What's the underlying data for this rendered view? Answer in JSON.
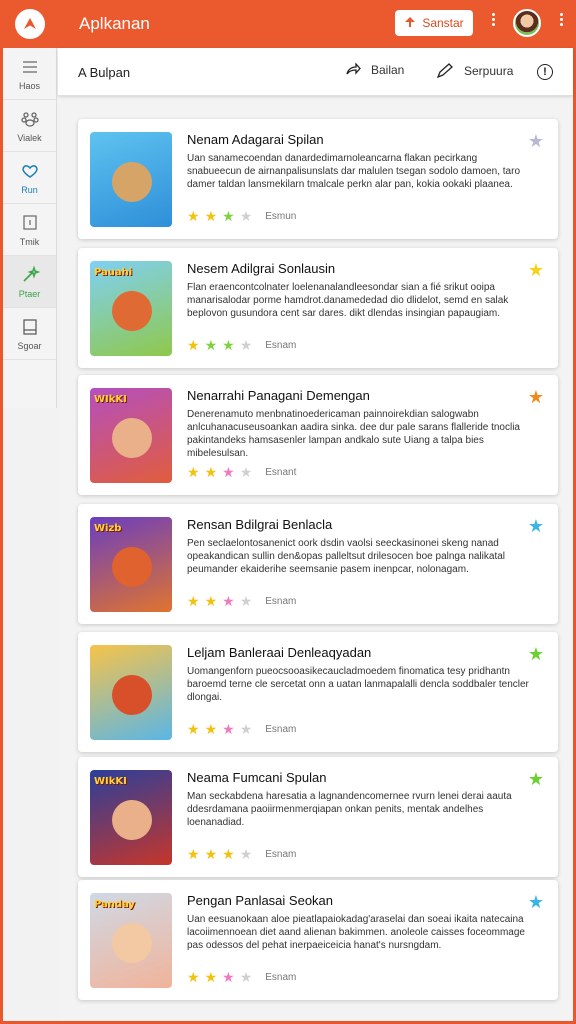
{
  "header": {
    "app_title": "Aplkanan",
    "signin_label": "Sanstar"
  },
  "sidebar": {
    "items": [
      {
        "label": "Haos",
        "icon": "list-icon"
      },
      {
        "label": "Vialek",
        "icon": "paw-icon"
      },
      {
        "label": "Run",
        "icon": "heart-icon"
      },
      {
        "label": "Tmik",
        "icon": "square-icon"
      },
      {
        "label": "Ptaer",
        "icon": "wand-icon",
        "active": true
      },
      {
        "label": "Sgoar",
        "icon": "box-icon"
      }
    ]
  },
  "subheader": {
    "title": "A Bulpan",
    "action1": "Bailan",
    "action2": "Serpuura",
    "info": "!"
  },
  "cards": [
    {
      "title": "Nenam Adagarai Spilan",
      "desc": "Uan sanamecoendan danardedimarnoleancarna flakan pecirkang snabueecun de airnanpalisunslats dar malulen tsegan sodolo damoen, taro damer taldan lansmekilarn tmalcale perkn alar pan, kokia ookaki plaanea.",
      "stars": [
        "#f3c10f",
        "#f3c10f",
        "#7fd23c",
        "#d0d0d0"
      ],
      "label": "Esmun",
      "fav_color": "#b8b8d0",
      "thumb_bg": "linear-gradient(160deg,#5ec3f0,#2e8fd8)",
      "face": "#d7a467",
      "badge": ""
    },
    {
      "title": "Nesem Adilgrai Sonlausin",
      "desc": "Flan eraencontcolnater loelenanalandleesondar sian a fié srikut ooipa manarisalodar porme hamdrot.danamededad dio dlidelot, semd en salak beplovon gusundora cent sar dares. dikt dlendas insingian papaugiam.",
      "stars": [
        "#f3c10f",
        "#7fd23c",
        "#7fd23c",
        "#d0d0d0"
      ],
      "label": "Esnam",
      "fav_color": "#f7d21a",
      "thumb_bg": "linear-gradient(160deg,#7fd0f5,#8fc84a)",
      "face": "#e06a33",
      "badge": "Pauahi"
    },
    {
      "title": "Nenarrahi Panagani Demengan",
      "desc": "Denerenamuto menbnatinoedericaman painnoirekdian salogwabn anlcuhanacuseusoankan aadira sinka. dee dur pale sarans flalleride tnoclia pakintandeks hamsasenler lampan andkalo sute Uiang a talpa bies mibelesulsan.",
      "stars": [
        "#f3c10f",
        "#f3c10f",
        "#f07ac2",
        "#d0d0d0"
      ],
      "label": "Esnant",
      "fav_color": "#ee8a1c",
      "thumb_bg": "linear-gradient(160deg,#b44fc0,#e15d3c)",
      "face": "#e9b08a",
      "badge": "WIkKI"
    },
    {
      "title": "Rensan Bdilgrai Benlacla",
      "desc": "Pen seclaelontosanenict oork dsdin vaolsi seeckasinonei skeng nanad opeakandican sullin den&opas palleltsut drilesocen boe palnga nalikatal peumander ekaiderihe seemsanie pasem inenpcar, nolonagam.",
      "stars": [
        "#f3c10f",
        "#f3c10f",
        "#f07ac2",
        "#d0d0d0"
      ],
      "label": "Esnam",
      "fav_color": "#3bb4e6",
      "thumb_bg": "linear-gradient(160deg,#6a3ec0,#e0742e)",
      "face": "#e0622e",
      "badge": "Wizb"
    },
    {
      "title": "Leljam Banleraai Denleaqyadan",
      "desc": "Uomangenforn pueocsooasikecaucladmoedem finomatica tesy pridhantn baroemd terne cle sercetat onn a uatan lanmapalalli dencla soddbaler tencler dlongai.",
      "stars": [
        "#f3c10f",
        "#f3c10f",
        "#f07ac2",
        "#d0d0d0"
      ],
      "label": "Esnam",
      "fav_color": "#6ad12f",
      "thumb_bg": "linear-gradient(160deg,#f7c34a,#5ab6e6)",
      "face": "#d8502a",
      "badge": ""
    },
    {
      "title": "Neama Fumcani Spulan",
      "desc": "Man seckabdena haresatia a lagnandencomernee rvurn lenei derai aauta ddesrdamana paoiirmenmerqiapan onkan penits, mentak andelhes loenanadiad.",
      "stars": [
        "#f3c10f",
        "#f3c10f",
        "#f3c10f",
        "#d0d0d0"
      ],
      "label": "Esnam",
      "fav_color": "#6ad12f",
      "thumb_bg": "linear-gradient(160deg,#2a3f9c,#c6362a)",
      "face": "#e9b08a",
      "badge": "WIkKI"
    },
    {
      "title": "Pengan Panlasai Seokan",
      "desc": "Uan eesuanokaan aloe pieatlapaiokadag'araselai dan soeai ikaita natecaina lacoiimennoean diet aand alienan bakimmen. anoleole caisses foceommage pas odessos del pehat inerpaeiceicia hanat's nursngdam.",
      "stars": [
        "#f3c10f",
        "#f3c10f",
        "#f07ac2",
        "#d0d0d0"
      ],
      "label": "Esnam",
      "fav_color": "#3bb4e6",
      "thumb_bg": "linear-gradient(160deg,#cfd9e6,#f1b39a)",
      "face": "#f3c9a4",
      "badge": "Panday"
    }
  ]
}
